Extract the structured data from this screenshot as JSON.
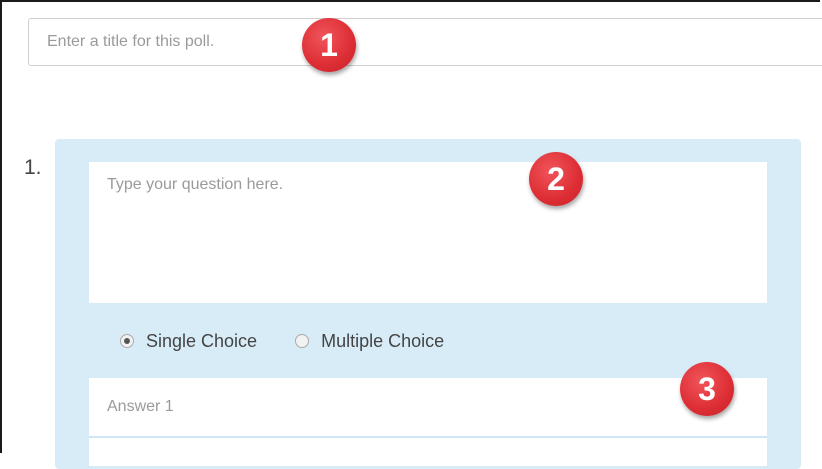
{
  "poll": {
    "title_placeholder": "Enter a title for this poll.",
    "title_value": ""
  },
  "question": {
    "number": "1.",
    "placeholder": "Type your question here.",
    "value": "",
    "choice_types": [
      {
        "label": "Single Choice",
        "selected": true
      },
      {
        "label": "Multiple Choice",
        "selected": false
      }
    ],
    "answers": [
      {
        "placeholder": "Answer 1",
        "value": ""
      },
      {
        "placeholder": "",
        "value": ""
      }
    ]
  },
  "callouts": [
    "1",
    "2",
    "3"
  ],
  "colors": {
    "panel": "#d8ecf8",
    "callout": "#dd2d34"
  }
}
